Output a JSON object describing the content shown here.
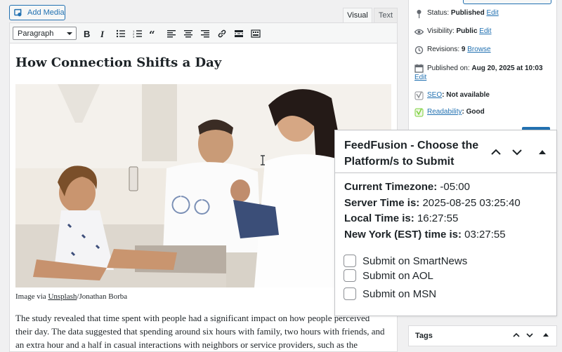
{
  "editor": {
    "add_media_label": "Add Media",
    "tabs": {
      "visual": "Visual",
      "text": "Text"
    },
    "format_select": "Paragraph",
    "toolbar_icons": [
      "bold-icon",
      "italic-icon",
      "bulleted-list-icon",
      "numbered-list-icon",
      "blockquote-icon",
      "align-left-icon",
      "align-center-icon",
      "align-right-icon",
      "link-icon",
      "read-more-icon",
      "toolbar-toggle-icon"
    ],
    "title": "How Connection Shifts a Day",
    "caption": {
      "prefix": "Image via ",
      "link": "Unsplash",
      "suffix": "/Jonathan Borba"
    },
    "body": "The study revealed that time spent with people had a significant impact on how people perceived their day. The data suggested that spending around six hours with family, two hours with friends, and an extra hour and a half in casual interactions with neighbors or service providers, such as the"
  },
  "publish": {
    "status_label": "Status:",
    "status_value": "Published",
    "visibility_label": "Visibility:",
    "visibility_value": "Public",
    "revisions_label": "Revisions:",
    "revisions_value": "9",
    "browse": "Browse",
    "published_label": "Published on:",
    "published_value": "Aug 20, 2025 at 10:03",
    "seo_label": "SEO",
    "seo_value": ": Not available",
    "readability_label": "Readability",
    "readability_value": ": Good",
    "edit": "Edit"
  },
  "feedfusion": {
    "title": "FeedFusion - Choose the Platform/s to Submit",
    "timezone_label": "Current Timezone:",
    "timezone_value": "-05:00",
    "server_label": "Server Time is:",
    "server_value": "2025-08-25 03:25:40",
    "local_label": "Local Time is:",
    "local_value": "16:27:55",
    "ny_label": "New York (EST) time is:",
    "ny_value": "03:27:55",
    "options": [
      "Submit on SmartNews",
      "Submit on AOL",
      "Submit on MSN"
    ]
  },
  "tags": {
    "label": "Tags"
  },
  "colors": {
    "link": "#2271b1",
    "text": "#1d2327",
    "border": "#dcdcde"
  }
}
